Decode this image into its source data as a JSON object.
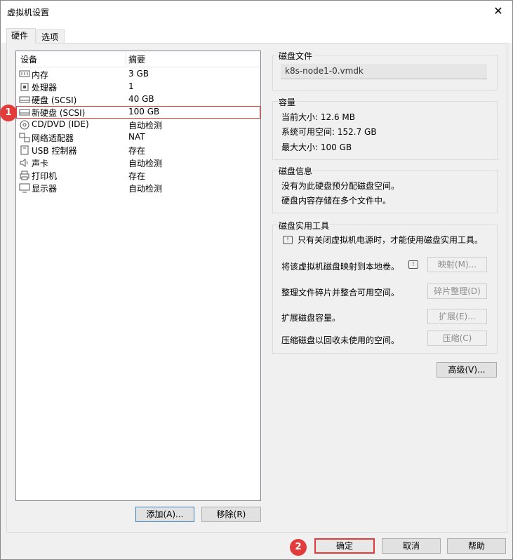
{
  "window": {
    "title": "虚拟机设置",
    "close_glyph": "✕"
  },
  "tabs": [
    {
      "label": "硬件"
    },
    {
      "label": "选项"
    }
  ],
  "device_list": {
    "col_device": "设备",
    "col_summary": "摘要",
    "rows": [
      {
        "icon": "memory-icon",
        "device": "内存",
        "summary": "3 GB"
      },
      {
        "icon": "processor-icon",
        "device": "处理器",
        "summary": "1"
      },
      {
        "icon": "hard-disk-icon",
        "device": "硬盘 (SCSI)",
        "summary": "40 GB"
      },
      {
        "icon": "hard-disk-icon",
        "device": "新硬盘 (SCSI)",
        "summary": "100 GB"
      },
      {
        "icon": "cd-dvd-icon",
        "device": "CD/DVD (IDE)",
        "summary": "自动检测"
      },
      {
        "icon": "network-adapter-icon",
        "device": "网络适配器",
        "summary": "NAT"
      },
      {
        "icon": "usb-icon",
        "device": "USB 控制器",
        "summary": "存在"
      },
      {
        "icon": "sound-card-icon",
        "device": "声卡",
        "summary": "自动检测"
      },
      {
        "icon": "printer-icon",
        "device": "打印机",
        "summary": "存在"
      },
      {
        "icon": "display-icon",
        "device": "显示器",
        "summary": "自动检测"
      }
    ]
  },
  "annotations": {
    "step1": "1",
    "step2": "2"
  },
  "buttons": {
    "add": "添加(A)...",
    "remove": "移除(R)",
    "ok": "确定",
    "cancel": "取消",
    "help": "帮助",
    "advanced": "高级(V)..."
  },
  "disk_file": {
    "label": "磁盘文件",
    "value": "k8s-node1-0.vmdk"
  },
  "capacity": {
    "label": "容量",
    "current": "当前大小: 12.6 MB",
    "available": "系统可用空间: 152.7 GB",
    "max": "最大大小: 100 GB"
  },
  "disk_info": {
    "label": "磁盘信息",
    "line1": "没有为此硬盘预分配磁盘空间。",
    "line2": "硬盘内容存储在多个文件中。"
  },
  "utilities": {
    "label": "磁盘实用工具",
    "notice": "只有关闭虚拟机电源时，才能使用磁盘实用工具。",
    "map_text": "将该虚拟机磁盘映射到本地卷。",
    "map_btn": "映射(M)...",
    "defrag_text": "整理文件碎片并整合可用空间。",
    "defrag_btn": "碎片整理(D)",
    "expand_text": "扩展磁盘容量。",
    "expand_btn": "扩展(E)...",
    "compact_text": "压缩磁盘以回收未使用的空间。",
    "compact_btn": "压缩(C)"
  }
}
